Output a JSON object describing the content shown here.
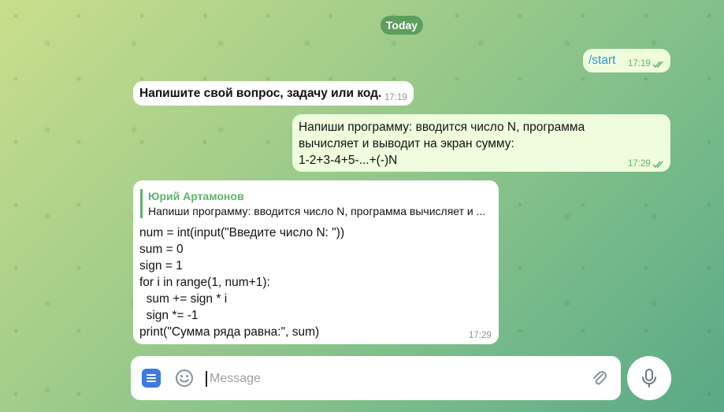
{
  "chat": {
    "date_divider": "Today",
    "messages": [
      {
        "direction": "outgoing",
        "text": "/start",
        "time": "17:19",
        "read": true
      },
      {
        "direction": "incoming",
        "text": "Напишите свой вопрос, задачу или код.",
        "time": "17:19"
      },
      {
        "direction": "outgoing",
        "lines": [
          "Напиши программу: вводится число N, программа",
          "вычисляет и выводит на экран сумму:",
          "1-2+3-4+5-...+(-)N"
        ],
        "time": "17:29",
        "read": true
      },
      {
        "direction": "incoming",
        "reply": {
          "author": "Юрий Артамонов",
          "text": "Напиши программу: вводится число N, программа вычисляет и ..."
        },
        "code": "num = int(input(\"Введите число N: \"))\nsum = 0\nsign = 1\nfor i in range(1, num+1):\n  sum += sign * i\n  sign *= -1\nprint(\"Сумма ряда равна:\", sum)",
        "time": "17:29"
      }
    ]
  },
  "composer": {
    "placeholder": "Message",
    "value": ""
  },
  "icons": {
    "menu": "menu-icon",
    "emoji": "emoji-icon",
    "attach": "paperclip-icon",
    "mic": "microphone-icon",
    "read": "double-check-icon"
  },
  "colors": {
    "outgoing_bubble": "#effdde",
    "incoming_bubble": "#ffffff",
    "accent_green": "#5fb36a",
    "link_blue": "#3a8fd6",
    "menu_blue": "#3b7ae0",
    "date_pill": "#5c9e5e"
  }
}
